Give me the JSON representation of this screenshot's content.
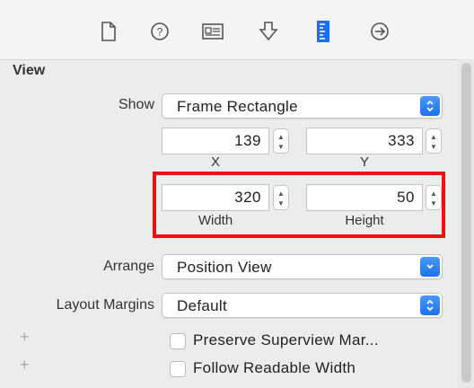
{
  "toolbar": {
    "tabs": [
      {
        "name": "file-inspector",
        "icon": "document-icon"
      },
      {
        "name": "quick-help",
        "icon": "help-circle-icon"
      },
      {
        "name": "identity-inspector",
        "icon": "id-card-icon"
      },
      {
        "name": "attributes-inspector",
        "icon": "shield-arrow-icon"
      },
      {
        "name": "size-inspector",
        "icon": "ruler-icon",
        "selected": true
      },
      {
        "name": "connections-inspector",
        "icon": "arrow-circle-icon"
      }
    ],
    "accent_color": "#1d6ff0"
  },
  "view": {
    "title": "View",
    "show": {
      "label": "Show",
      "value": "Frame Rectangle"
    },
    "x": {
      "value": "139",
      "label": "X"
    },
    "y": {
      "value": "333",
      "label": "Y"
    },
    "width": {
      "value": "320",
      "label": "Width"
    },
    "height": {
      "value": "50",
      "label": "Height"
    },
    "arrange": {
      "label": "Arrange",
      "value": "Position View"
    },
    "layout_margins": {
      "label": "Layout Margins",
      "value": "Default"
    },
    "preserve_superview": {
      "label": "Preserve Superview Mar...",
      "checked": false
    },
    "follow_readable": {
      "label": "Follow Readable Width",
      "checked": false
    }
  },
  "annotation": {
    "color": "#ee1111"
  }
}
